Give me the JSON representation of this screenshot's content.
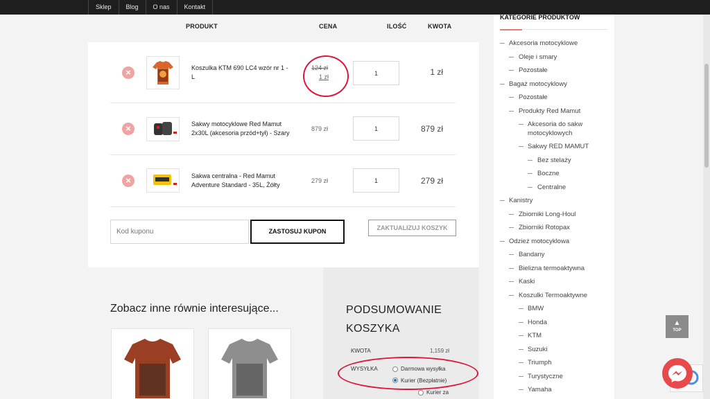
{
  "top_nav": [
    "Sklep",
    "Blog",
    "O nas",
    "Kontakt"
  ],
  "cart": {
    "headers": {
      "product": "PRODUKT",
      "price": "CENA",
      "quantity": "ILOŚĆ",
      "amount": "KWOTA"
    },
    "remove_symbol": "×",
    "items": [
      {
        "name": "Koszulka KTM 690 LC4 wzór nr 1 - L",
        "price_old": "124 zł",
        "price": "1 zł",
        "quantity": "1",
        "total": "1 zł",
        "thumb": "orange-tshirt"
      },
      {
        "name": "Sakwy motocyklowe Red Mamut 2x30L (akcesoria przód+tył) - Szary",
        "price": "879 zł",
        "quantity": "1",
        "total": "879 zł",
        "thumb": "saddlebags"
      },
      {
        "name": "Sakwa centralna - Red Mamut Adventure Standard - 35L, Żółty",
        "price": "279 zł",
        "quantity": "1",
        "total": "279 zł",
        "thumb": "yellow-bag"
      }
    ],
    "coupon_placeholder": "Kod kuponu",
    "apply_coupon": "ZASTOSUJ KUPON",
    "update_cart": "ZAKTUALIZUJ KOSZYK"
  },
  "related": {
    "title": "Zobacz inne równie interesujące...",
    "items": [
      {
        "thumb": "rust-motorcycle-tshirt"
      },
      {
        "thumb": "grey-motorcycle-tshirt"
      }
    ]
  },
  "summary": {
    "title": "PODSUMOWANIE KOSZYKA",
    "amount_label": "KWOTA",
    "amount_value": "1,159 zł",
    "shipping_label": "WYSYŁKA",
    "shipping_options": [
      "Darmowa wysyłka",
      "Kurier (Bezpłatnie)",
      "Kurier za"
    ],
    "selected_shipping": "Kurier (Bezpłatnie)"
  },
  "sidebar": {
    "title": "KATEGORIE PRODUKTÓW",
    "categories": [
      {
        "label": "Akcesoria motocyklowe",
        "level": 0
      },
      {
        "label": "Oleje i smary",
        "level": 1
      },
      {
        "label": "Pozostałe",
        "level": 1
      },
      {
        "label": "Bagaż motocyklowy",
        "level": 0
      },
      {
        "label": "Pozostałe",
        "level": 1
      },
      {
        "label": "Produkty Red Mamut",
        "level": 1
      },
      {
        "label": "Akcesoria do sakw motocyklowych",
        "level": 2
      },
      {
        "label": "Sakwy RED MAMUT",
        "level": 2
      },
      {
        "label": "Bez stelaży",
        "level": 3
      },
      {
        "label": "Boczne",
        "level": 3
      },
      {
        "label": "Centralne",
        "level": 3
      },
      {
        "label": "Kanistry",
        "level": 0
      },
      {
        "label": "Zbiorniki Long-Houl",
        "level": 1
      },
      {
        "label": "Zbiorniki Rotopax",
        "level": 1
      },
      {
        "label": "Odzież motocyklowa",
        "level": 0
      },
      {
        "label": "Bandany",
        "level": 1
      },
      {
        "label": "Bielizna termoaktywna",
        "level": 1
      },
      {
        "label": "Kaski",
        "level": 1
      },
      {
        "label": "Koszulki Termoaktywne",
        "level": 1
      },
      {
        "label": "BMW",
        "level": 2
      },
      {
        "label": "Honda",
        "level": 2
      },
      {
        "label": "KTM",
        "level": 2
      },
      {
        "label": "Suzuki",
        "level": 2
      },
      {
        "label": "Triumph",
        "level": 2
      },
      {
        "label": "Turystyczne",
        "level": 2
      },
      {
        "label": "Yamaha",
        "level": 2
      }
    ]
  },
  "top_button": {
    "arrow": "▲",
    "label": "TOP"
  },
  "colors": {
    "annotation_red": "#e0143c",
    "remove_pink": "#f0a3a3",
    "messenger_red": "#e8494a"
  }
}
